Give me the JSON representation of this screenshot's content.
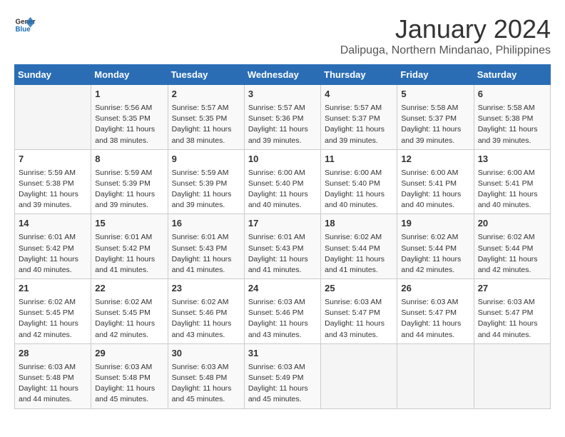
{
  "header": {
    "logo_line1": "General",
    "logo_line2": "Blue",
    "main_title": "January 2024",
    "subtitle": "Dalipuga, Northern Mindanao, Philippines"
  },
  "days_of_week": [
    "Sunday",
    "Monday",
    "Tuesday",
    "Wednesday",
    "Thursday",
    "Friday",
    "Saturday"
  ],
  "weeks": [
    [
      {
        "day": "",
        "sunrise": "",
        "sunset": "",
        "daylight": "",
        "empty": true
      },
      {
        "day": "1",
        "sunrise": "Sunrise: 5:56 AM",
        "sunset": "Sunset: 5:35 PM",
        "daylight": "Daylight: 11 hours and 38 minutes."
      },
      {
        "day": "2",
        "sunrise": "Sunrise: 5:57 AM",
        "sunset": "Sunset: 5:35 PM",
        "daylight": "Daylight: 11 hours and 38 minutes."
      },
      {
        "day": "3",
        "sunrise": "Sunrise: 5:57 AM",
        "sunset": "Sunset: 5:36 PM",
        "daylight": "Daylight: 11 hours and 39 minutes."
      },
      {
        "day": "4",
        "sunrise": "Sunrise: 5:57 AM",
        "sunset": "Sunset: 5:37 PM",
        "daylight": "Daylight: 11 hours and 39 minutes."
      },
      {
        "day": "5",
        "sunrise": "Sunrise: 5:58 AM",
        "sunset": "Sunset: 5:37 PM",
        "daylight": "Daylight: 11 hours and 39 minutes."
      },
      {
        "day": "6",
        "sunrise": "Sunrise: 5:58 AM",
        "sunset": "Sunset: 5:38 PM",
        "daylight": "Daylight: 11 hours and 39 minutes."
      }
    ],
    [
      {
        "day": "7",
        "sunrise": "Sunrise: 5:59 AM",
        "sunset": "Sunset: 5:38 PM",
        "daylight": "Daylight: 11 hours and 39 minutes."
      },
      {
        "day": "8",
        "sunrise": "Sunrise: 5:59 AM",
        "sunset": "Sunset: 5:39 PM",
        "daylight": "Daylight: 11 hours and 39 minutes."
      },
      {
        "day": "9",
        "sunrise": "Sunrise: 5:59 AM",
        "sunset": "Sunset: 5:39 PM",
        "daylight": "Daylight: 11 hours and 39 minutes."
      },
      {
        "day": "10",
        "sunrise": "Sunrise: 6:00 AM",
        "sunset": "Sunset: 5:40 PM",
        "daylight": "Daylight: 11 hours and 40 minutes."
      },
      {
        "day": "11",
        "sunrise": "Sunrise: 6:00 AM",
        "sunset": "Sunset: 5:40 PM",
        "daylight": "Daylight: 11 hours and 40 minutes."
      },
      {
        "day": "12",
        "sunrise": "Sunrise: 6:00 AM",
        "sunset": "Sunset: 5:41 PM",
        "daylight": "Daylight: 11 hours and 40 minutes."
      },
      {
        "day": "13",
        "sunrise": "Sunrise: 6:00 AM",
        "sunset": "Sunset: 5:41 PM",
        "daylight": "Daylight: 11 hours and 40 minutes."
      }
    ],
    [
      {
        "day": "14",
        "sunrise": "Sunrise: 6:01 AM",
        "sunset": "Sunset: 5:42 PM",
        "daylight": "Daylight: 11 hours and 40 minutes."
      },
      {
        "day": "15",
        "sunrise": "Sunrise: 6:01 AM",
        "sunset": "Sunset: 5:42 PM",
        "daylight": "Daylight: 11 hours and 41 minutes."
      },
      {
        "day": "16",
        "sunrise": "Sunrise: 6:01 AM",
        "sunset": "Sunset: 5:43 PM",
        "daylight": "Daylight: 11 hours and 41 minutes."
      },
      {
        "day": "17",
        "sunrise": "Sunrise: 6:01 AM",
        "sunset": "Sunset: 5:43 PM",
        "daylight": "Daylight: 11 hours and 41 minutes."
      },
      {
        "day": "18",
        "sunrise": "Sunrise: 6:02 AM",
        "sunset": "Sunset: 5:44 PM",
        "daylight": "Daylight: 11 hours and 41 minutes."
      },
      {
        "day": "19",
        "sunrise": "Sunrise: 6:02 AM",
        "sunset": "Sunset: 5:44 PM",
        "daylight": "Daylight: 11 hours and 42 minutes."
      },
      {
        "day": "20",
        "sunrise": "Sunrise: 6:02 AM",
        "sunset": "Sunset: 5:44 PM",
        "daylight": "Daylight: 11 hours and 42 minutes."
      }
    ],
    [
      {
        "day": "21",
        "sunrise": "Sunrise: 6:02 AM",
        "sunset": "Sunset: 5:45 PM",
        "daylight": "Daylight: 11 hours and 42 minutes."
      },
      {
        "day": "22",
        "sunrise": "Sunrise: 6:02 AM",
        "sunset": "Sunset: 5:45 PM",
        "daylight": "Daylight: 11 hours and 42 minutes."
      },
      {
        "day": "23",
        "sunrise": "Sunrise: 6:02 AM",
        "sunset": "Sunset: 5:46 PM",
        "daylight": "Daylight: 11 hours and 43 minutes."
      },
      {
        "day": "24",
        "sunrise": "Sunrise: 6:03 AM",
        "sunset": "Sunset: 5:46 PM",
        "daylight": "Daylight: 11 hours and 43 minutes."
      },
      {
        "day": "25",
        "sunrise": "Sunrise: 6:03 AM",
        "sunset": "Sunset: 5:47 PM",
        "daylight": "Daylight: 11 hours and 43 minutes."
      },
      {
        "day": "26",
        "sunrise": "Sunrise: 6:03 AM",
        "sunset": "Sunset: 5:47 PM",
        "daylight": "Daylight: 11 hours and 44 minutes."
      },
      {
        "day": "27",
        "sunrise": "Sunrise: 6:03 AM",
        "sunset": "Sunset: 5:47 PM",
        "daylight": "Daylight: 11 hours and 44 minutes."
      }
    ],
    [
      {
        "day": "28",
        "sunrise": "Sunrise: 6:03 AM",
        "sunset": "Sunset: 5:48 PM",
        "daylight": "Daylight: 11 hours and 44 minutes."
      },
      {
        "day": "29",
        "sunrise": "Sunrise: 6:03 AM",
        "sunset": "Sunset: 5:48 PM",
        "daylight": "Daylight: 11 hours and 45 minutes."
      },
      {
        "day": "30",
        "sunrise": "Sunrise: 6:03 AM",
        "sunset": "Sunset: 5:48 PM",
        "daylight": "Daylight: 11 hours and 45 minutes."
      },
      {
        "day": "31",
        "sunrise": "Sunrise: 6:03 AM",
        "sunset": "Sunset: 5:49 PM",
        "daylight": "Daylight: 11 hours and 45 minutes."
      },
      {
        "day": "",
        "sunrise": "",
        "sunset": "",
        "daylight": "",
        "empty": true
      },
      {
        "day": "",
        "sunrise": "",
        "sunset": "",
        "daylight": "",
        "empty": true
      },
      {
        "day": "",
        "sunrise": "",
        "sunset": "",
        "daylight": "",
        "empty": true
      }
    ]
  ]
}
